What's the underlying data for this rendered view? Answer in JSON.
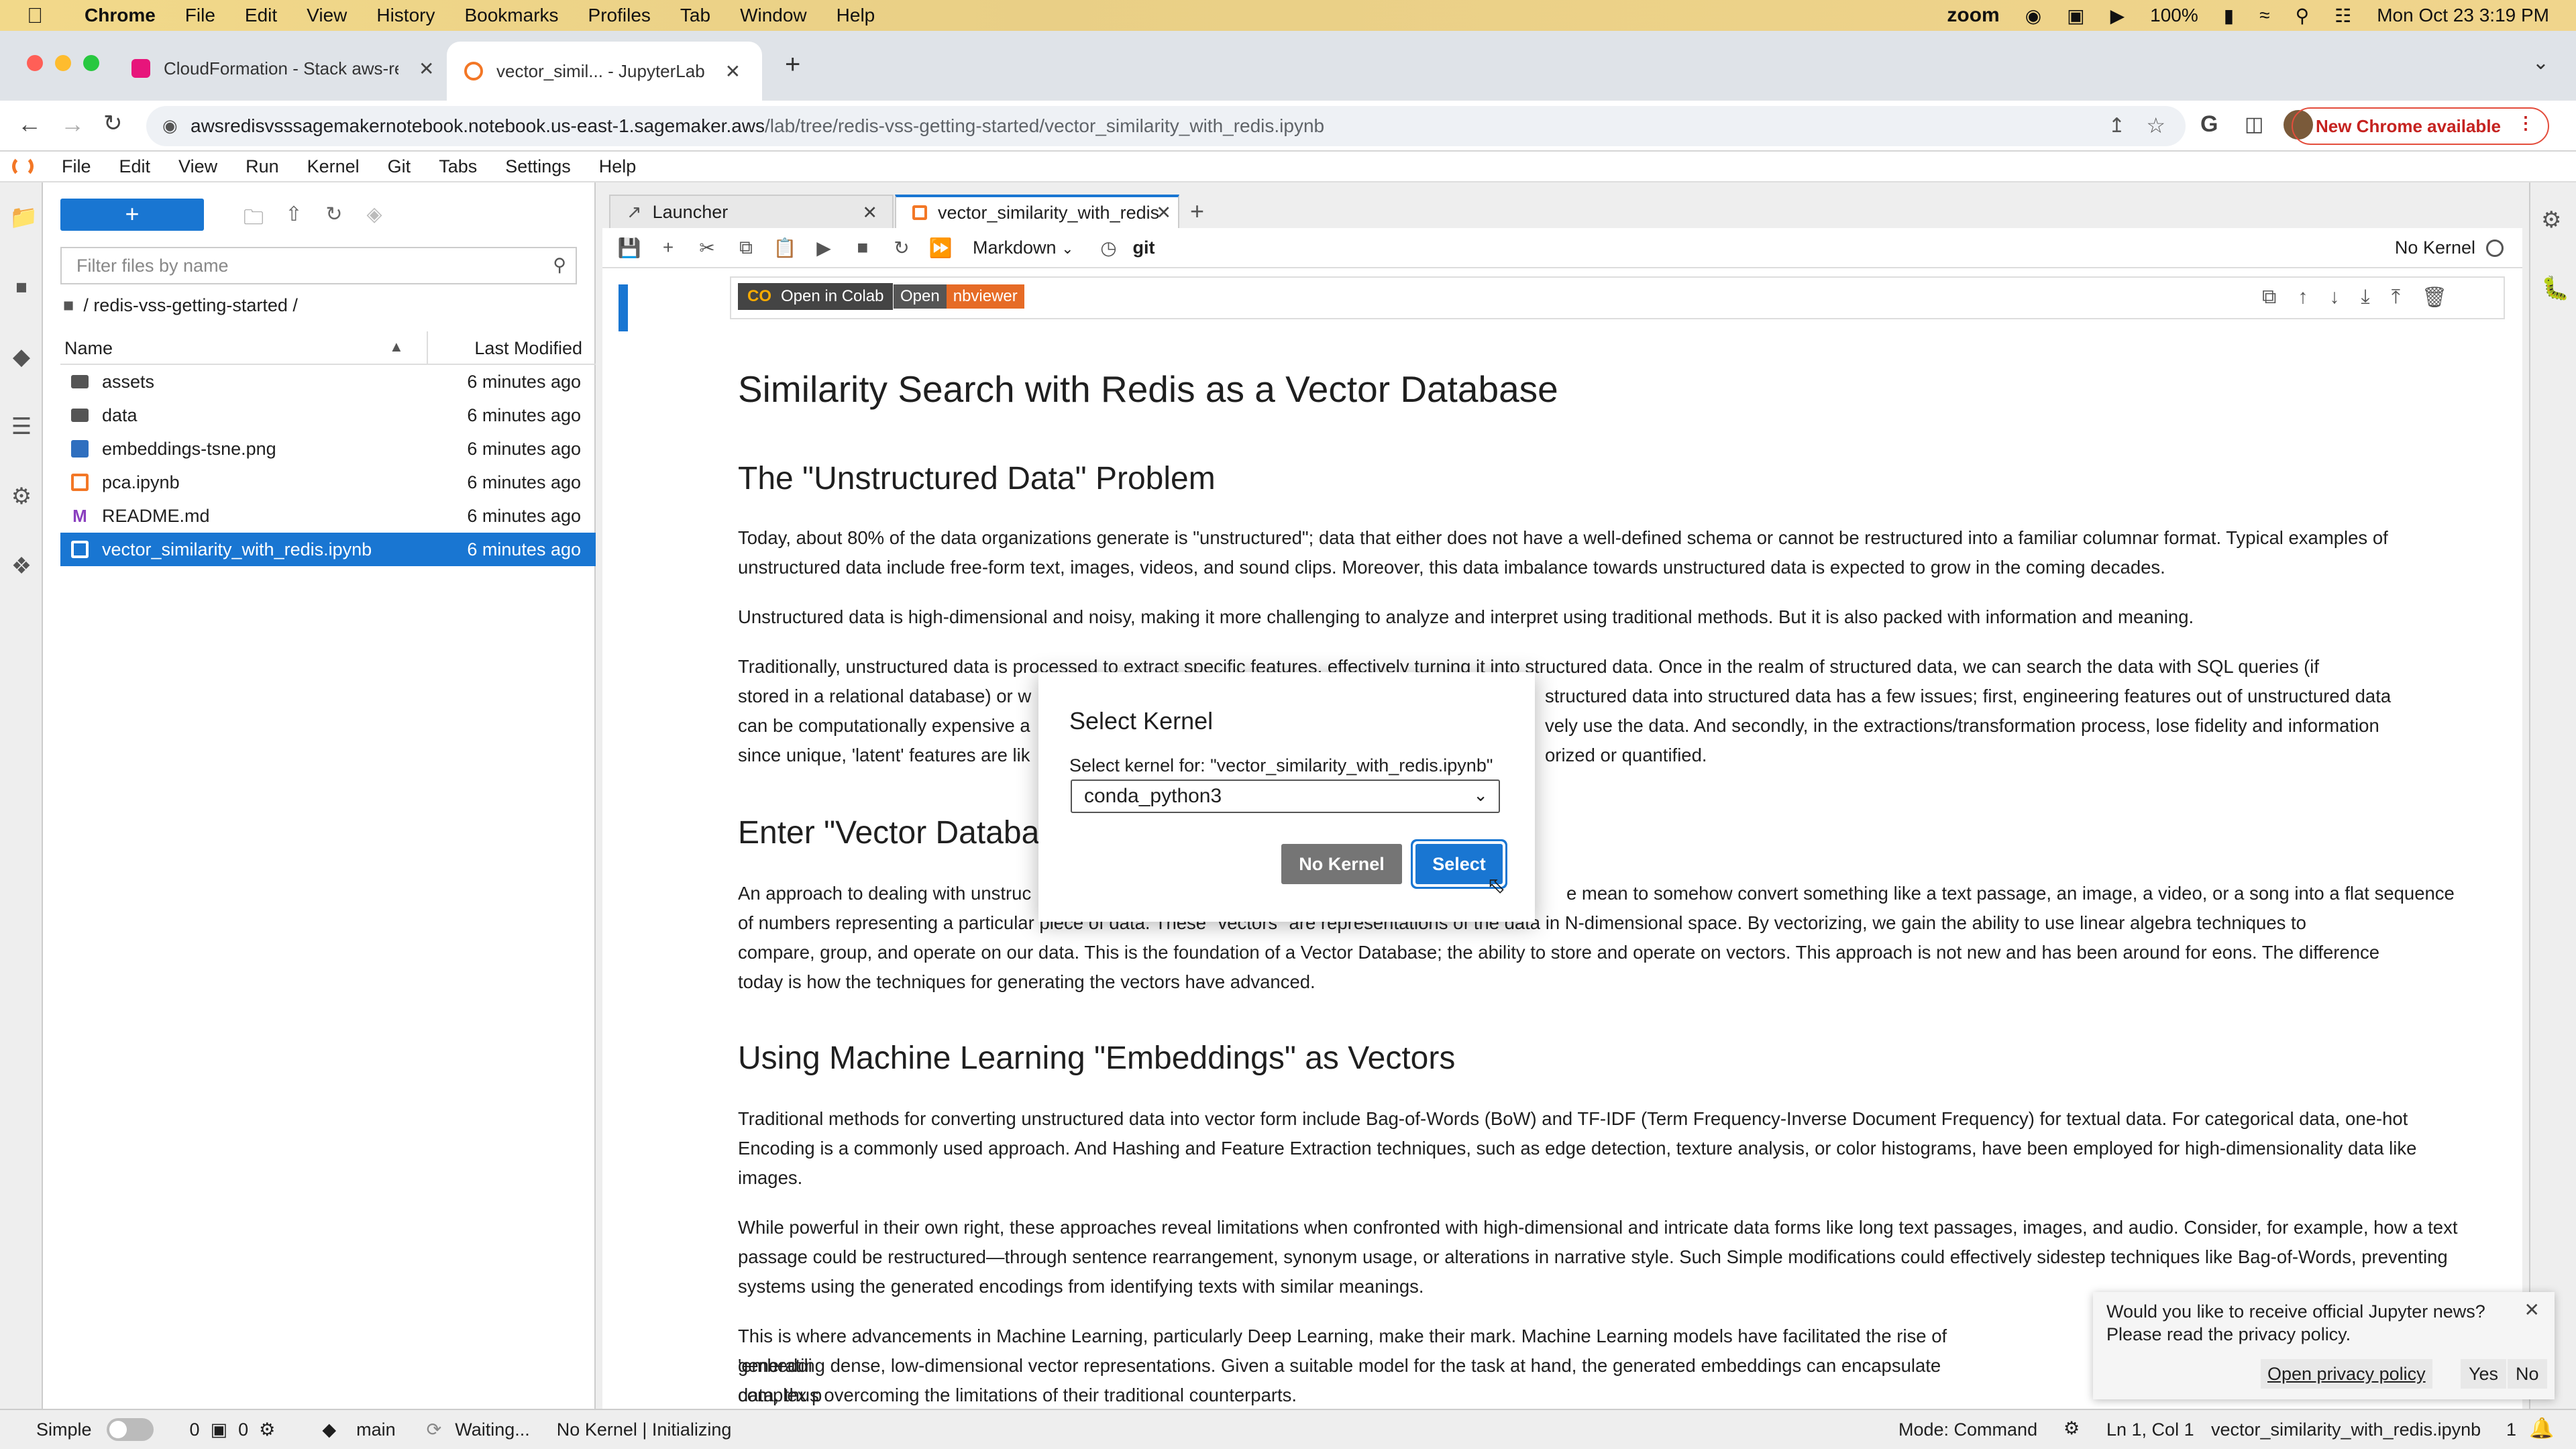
{
  "menubar": {
    "app": "Chrome",
    "items": [
      "File",
      "Edit",
      "View",
      "History",
      "Bookmarks",
      "Profiles",
      "Tab",
      "Window",
      "Help"
    ],
    "zoom": "zoom",
    "battery": "100%",
    "datetime": "Mon Oct 23  3:19 PM"
  },
  "browser": {
    "tabs": [
      {
        "label": "CloudFormation - Stack aws-re",
        "active": false
      },
      {
        "label": "vector_simil... - JupyterLab",
        "active": true
      }
    ],
    "url_host": "awsredisvsssagemakernotebook.notebook.us-east-1.sagemaker.aws",
    "url_path": "/lab/tree/redis-vss-getting-started/vector_similarity_with_redis.ipynb",
    "new_chrome": "New Chrome available"
  },
  "jupyter": {
    "menu": [
      "File",
      "Edit",
      "View",
      "Run",
      "Kernel",
      "Git",
      "Tabs",
      "Settings",
      "Help"
    ],
    "file_browser": {
      "new_label": "+",
      "filter_placeholder": "Filter files by name",
      "breadcrumb": "/ redis-vss-getting-started /",
      "col_name": "Name",
      "col_modified": "Last Modified",
      "files": [
        {
          "name": "assets",
          "modified": "6 minutes ago",
          "type": "folder"
        },
        {
          "name": "data",
          "modified": "6 minutes ago",
          "type": "folder"
        },
        {
          "name": "embeddings-tsne.png",
          "modified": "6 minutes ago",
          "type": "image"
        },
        {
          "name": "pca.ipynb",
          "modified": "6 minutes ago",
          "type": "notebook"
        },
        {
          "name": "README.md",
          "modified": "6 minutes ago",
          "type": "markdown"
        },
        {
          "name": "vector_similarity_with_redis.ipynb",
          "modified": "6 minutes ago",
          "type": "notebook",
          "selected": true
        }
      ]
    },
    "doc_tabs": [
      {
        "label": "Launcher"
      },
      {
        "label": "vector_similarity_with_redis"
      }
    ],
    "toolbar": {
      "cell_type": "Markdown",
      "git": "git",
      "kernel": "No Kernel"
    },
    "notebook": {
      "badge_colab": "Open in Colab",
      "badge_open": "Open",
      "badge_nbviewer": "nbviewer",
      "title": "Similarity Search with Redis as a Vector Database",
      "h_unstructured": "The \"Unstructured Data\" Problem",
      "p1": "Today, about 80% of the data organizations generate is \"unstructured\"; data that either does not have a well-defined schema or cannot be restructured into a familiar columnar format. Typical examples of unstructured data include free-form text, images, videos, and sound clips. Moreover, this data imbalance towards unstructured data is expected to grow in the coming decades.",
      "p2": "Unstructured data is high-dimensional and noisy, making it more challenging to analyze and interpret using traditional methods. But it is also packed with information and meaning.",
      "p3a": "Traditionally, unstructured data is processed to extract specific features, effectively turning it into structured data. Once in the realm of structured data, we can search the data with SQL queries (if",
      "p3b": "stored in a relational database) or w",
      "p3b_r": "structured data into structured data has a few issues; first, engineering features out of unstructured data",
      "p3c": "can be computationally expensive a",
      "p3c_r": "vely use the data. And secondly, in the extractions/transformation process, lose fidelity and information",
      "p3d": "since unique, 'latent' features are lik",
      "p3d_r": "orized or quantified.",
      "h_vector": "Enter \"Vector Databas",
      "p4a": "An approach to dealing with unstruc",
      "p4a_r": "e mean to somehow convert something like a text passage, an image, a video, or a song into a flat sequence",
      "p4b": "of numbers representing a particular piece of data. These \"vectors\" are representations of the data in N-dimensional space. By vectorizing, we gain the ability to use linear algebra techniques to",
      "p4c": "compare, group, and operate on our data. This is the foundation of a Vector Database; the ability to store and operate on vectors. This approach is not new and has been around for eons. The difference",
      "p4d": "today is how the techniques for generating the vectors have advanced.",
      "h_ml": "Using Machine Learning \"Embeddings\" as Vectors",
      "p5": "Traditional methods for converting unstructured data into vector form include Bag-of-Words (BoW) and TF-IDF (Term Frequency-Inverse Document Frequency) for textual data. For categorical data, one-hot Encoding is a commonly used approach. And Hashing and Feature Extraction techniques, such as edge detection, texture analysis, or color histograms, have been employed for high-dimensionality data like images.",
      "p6": "While powerful in their own right, these approaches reveal limitations when confronted with high-dimensional and intricate data forms like long text passages, images, and audio. Consider, for example, how a text passage could be restructured—through sentence rearrangement, synonym usage, or alterations in narrative style. Such Simple modifications could effectively sidestep techniques like Bag-of-Words, preventing systems using the generated encodings from identifying texts with similar meanings.",
      "p7a": "This is where advancements in Machine Learning, particularly Deep Learning, make their mark. Machine Learning models have facilitated the rise of 'embeddi",
      "p7b": "generating dense, low-dimensional vector representations. Given a suitable model for the task at hand, the generated embeddings can encapsulate complex p",
      "p7c": "data, thus overcoming the limitations of their traditional counterparts."
    },
    "dialog": {
      "title": "Select Kernel",
      "label": "Select kernel for: \"vector_similarity_with_redis.ipynb\"",
      "selected": "conda_python3",
      "no_kernel": "No Kernel",
      "select": "Select"
    },
    "toast": {
      "message1": "Would you like to receive official Jupyter news?",
      "message2": "Please read the privacy policy.",
      "open_policy": "Open privacy policy",
      "yes": "Yes",
      "no": "No"
    },
    "status": {
      "mode_simple": "Simple",
      "count1": "0",
      "count2": "0",
      "branch": "main",
      "git_status": "Waiting...",
      "kernel_status": "No Kernel | Initializing",
      "mode": "Mode: Command",
      "position": "Ln 1, Col 1",
      "filename": "vector_similarity_with_redis.ipynb",
      "notifications": "1"
    }
  }
}
